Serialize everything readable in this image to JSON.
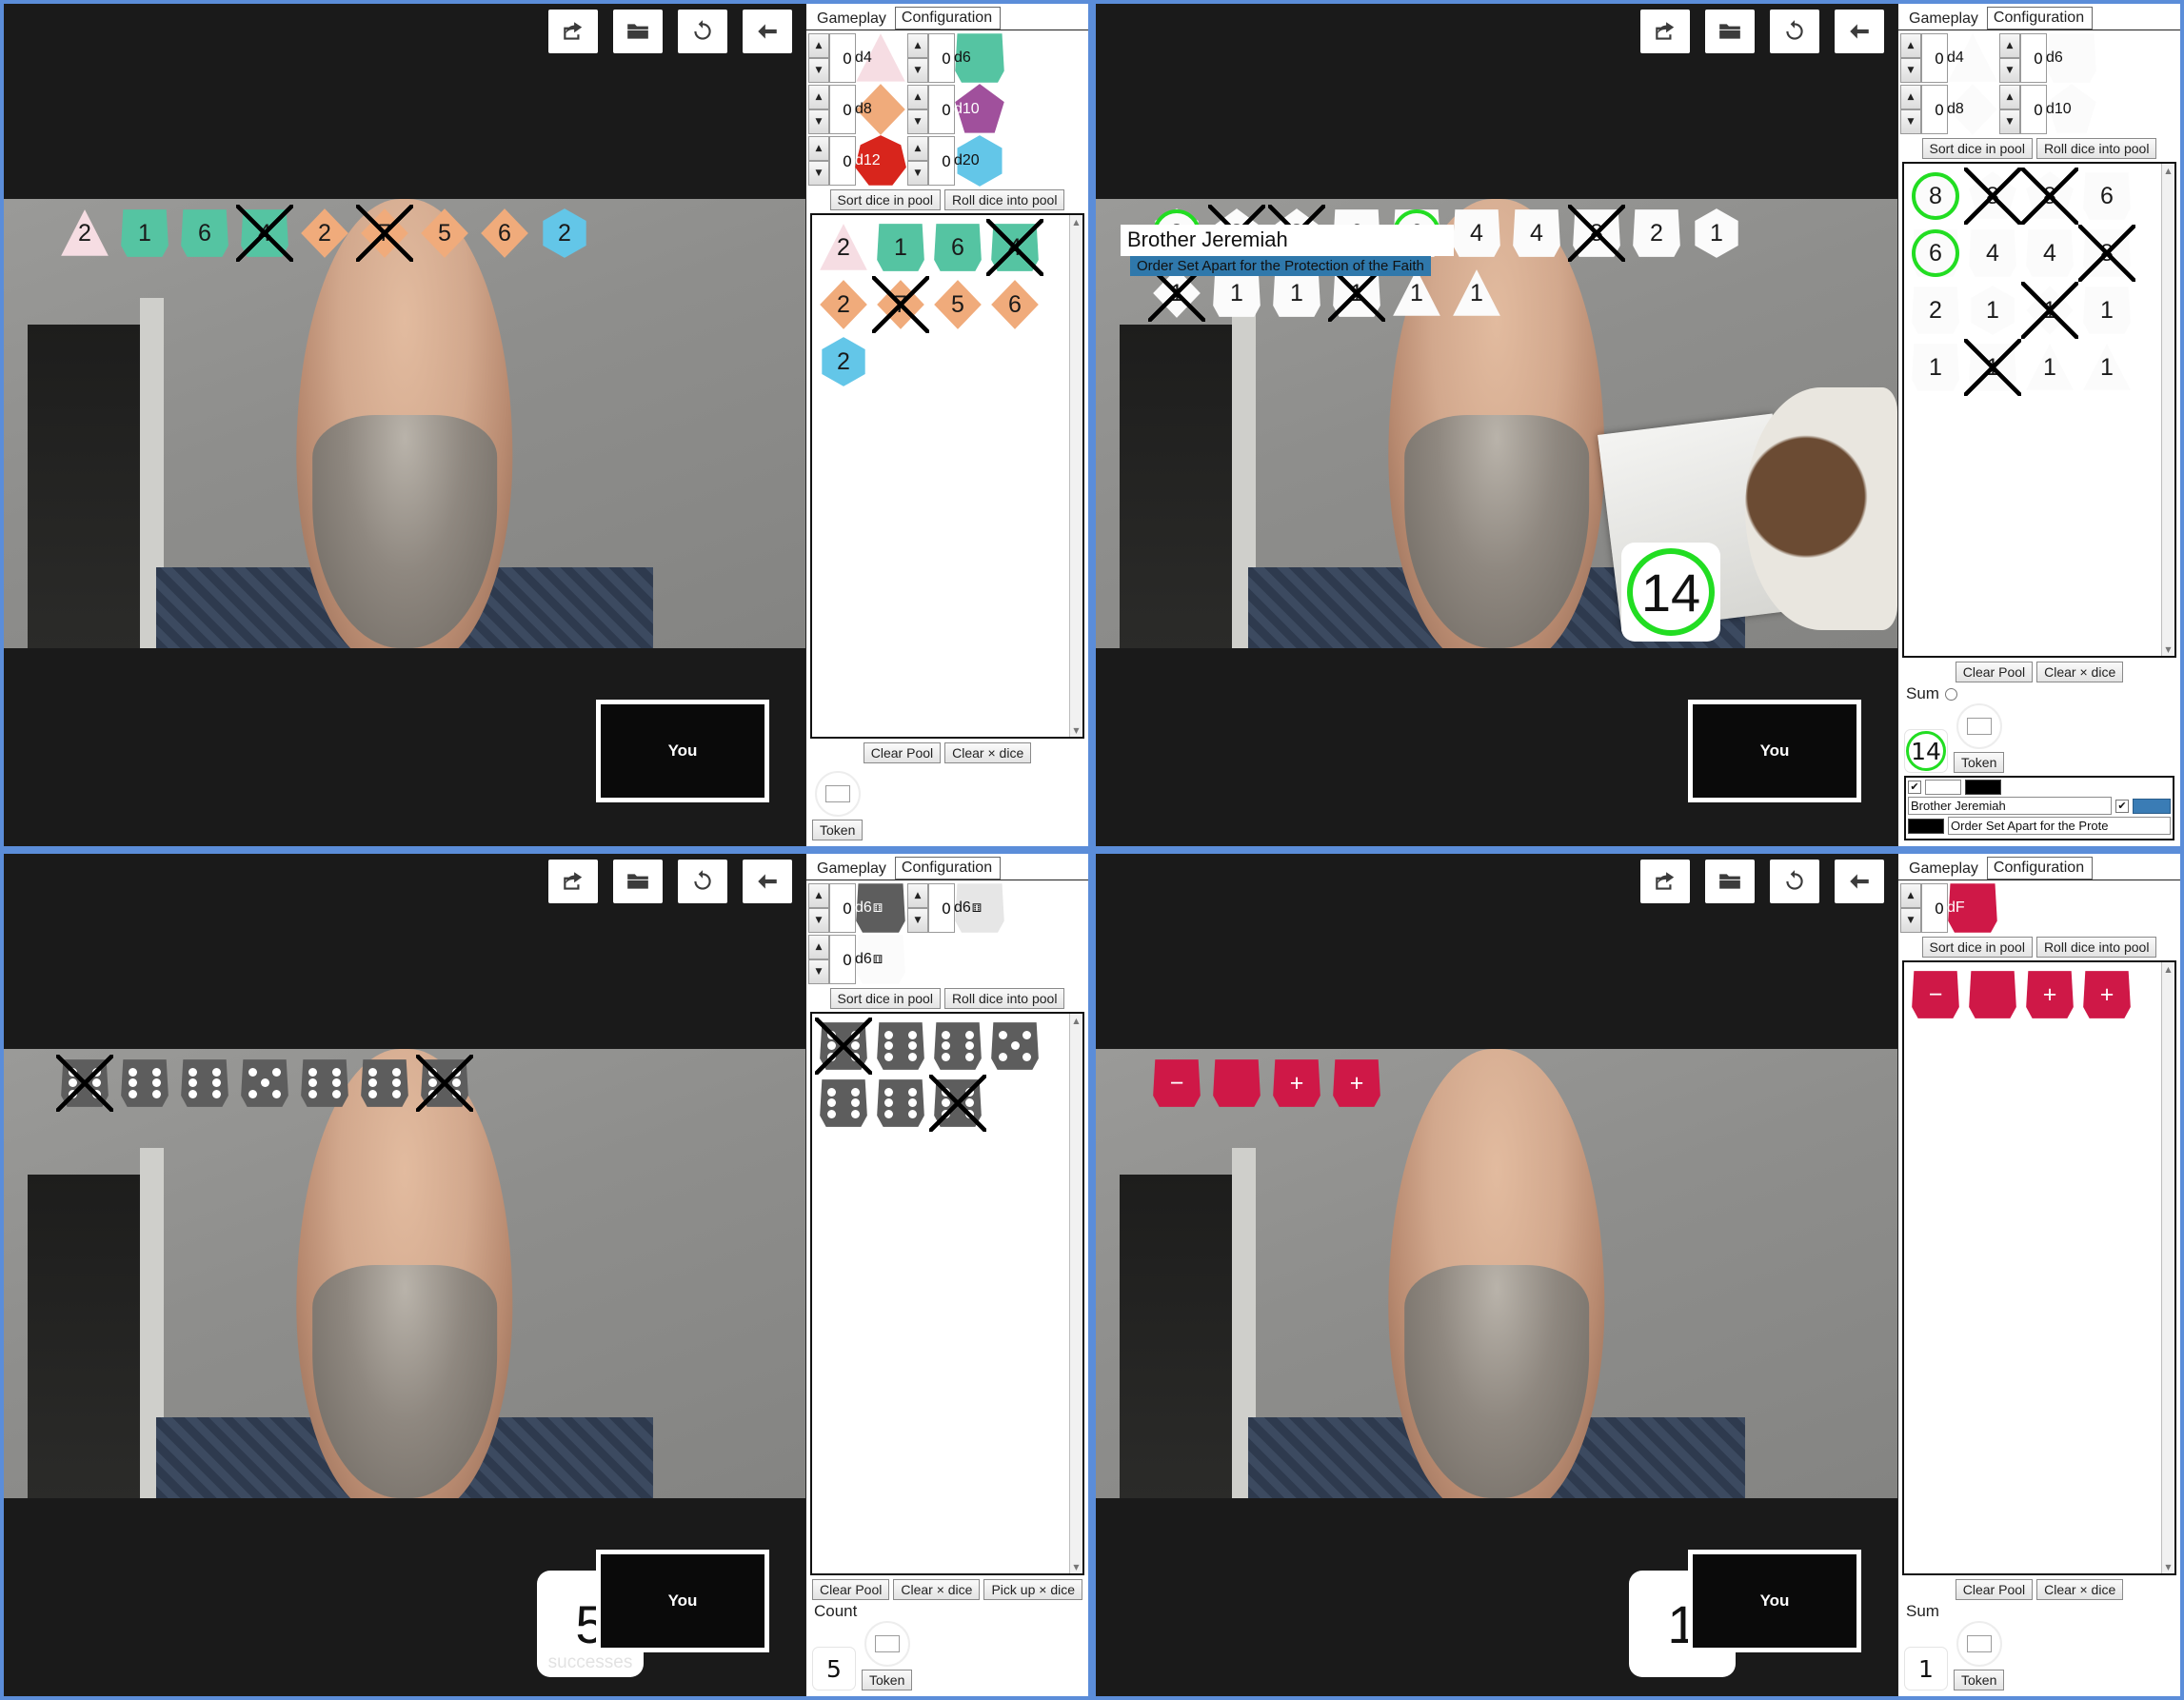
{
  "toolbar": {
    "buttons": [
      {
        "name": "share-icon",
        "label": "Share"
      },
      {
        "name": "folder-icon",
        "label": "Open"
      },
      {
        "name": "refresh-icon",
        "label": "Reload"
      },
      {
        "name": "back-arrow-icon",
        "label": "Back"
      }
    ]
  },
  "tabs": {
    "gameplay": "Gameplay",
    "configuration": "Configuration"
  },
  "buttons": {
    "sort": "Sort dice in pool",
    "roll": "Roll dice into pool",
    "clear_pool": "Clear Pool",
    "clear_x": "Clear × dice",
    "pickup_x": "Pick up × dice",
    "token": "Token"
  },
  "selfview_label": "You",
  "labels": {
    "sum": "Sum",
    "count": "Count",
    "successes": "successes"
  },
  "panels": [
    {
      "id": "panel-polyhedral-color",
      "theme": "color",
      "spinners": [
        {
          "label": "d4",
          "value": "0",
          "shape": "d4",
          "color": "c-d4",
          "text": "dark"
        },
        {
          "label": "d6",
          "value": "0",
          "shape": "d6",
          "color": "c-d6",
          "text": "dark"
        },
        {
          "label": "d8",
          "value": "0",
          "shape": "d8",
          "color": "c-d8",
          "text": "dark"
        },
        {
          "label": "d10",
          "value": "0",
          "shape": "d10",
          "color": "c-d10",
          "text": "light"
        },
        {
          "label": "d12",
          "value": "0",
          "shape": "d12",
          "color": "c-d12",
          "text": "light"
        },
        {
          "label": "d20",
          "value": "0",
          "shape": "d20",
          "color": "c-d20",
          "text": "dark"
        }
      ],
      "pool": [
        {
          "value": "2",
          "shape": "d4",
          "color": "c-d4",
          "x": false,
          "picked": false
        },
        {
          "value": "1",
          "shape": "d6",
          "color": "c-d6",
          "x": false,
          "picked": false
        },
        {
          "value": "6",
          "shape": "d6",
          "color": "c-d6",
          "x": false,
          "picked": false
        },
        {
          "value": "4",
          "shape": "d6",
          "color": "c-d6",
          "x": true,
          "picked": false
        },
        {
          "value": "2",
          "shape": "d8",
          "color": "c-d8",
          "x": false,
          "picked": false
        },
        {
          "value": "7",
          "shape": "d8",
          "color": "c-d8",
          "x": true,
          "picked": false
        },
        {
          "value": "5",
          "shape": "d8",
          "color": "c-d8",
          "x": false,
          "picked": false
        },
        {
          "value": "6",
          "shape": "d8",
          "color": "c-d8",
          "x": false,
          "picked": false
        },
        {
          "value": "2",
          "shape": "d20",
          "color": "c-d20",
          "x": false,
          "picked": false
        }
      ],
      "overlay_dice": [
        {
          "value": "2",
          "shape": "d4",
          "color": "c-d4",
          "x": false,
          "picked": false
        },
        {
          "value": "1",
          "shape": "d6",
          "color": "c-d6",
          "x": false,
          "picked": false
        },
        {
          "value": "6",
          "shape": "d6",
          "color": "c-d6",
          "x": false,
          "picked": false
        },
        {
          "value": "4",
          "shape": "d6",
          "color": "c-d6",
          "x": true,
          "picked": false
        },
        {
          "value": "2",
          "shape": "d8",
          "color": "c-d8",
          "x": false,
          "picked": false
        },
        {
          "value": "7",
          "shape": "d8",
          "color": "c-d8",
          "x": true,
          "picked": false
        },
        {
          "value": "5",
          "shape": "d8",
          "color": "c-d8",
          "x": false,
          "picked": false
        },
        {
          "value": "6",
          "shape": "d8",
          "color": "c-d8",
          "x": false,
          "picked": false
        },
        {
          "value": "2",
          "shape": "d20",
          "color": "c-d20",
          "x": false,
          "picked": false
        }
      ],
      "footer": {
        "mode": "none",
        "result": "",
        "foot_buttons": [
          "Clear Pool",
          "Clear × dice"
        ]
      }
    },
    {
      "id": "panel-polyhedral-white",
      "theme": "white",
      "spinners": [
        {
          "label": "d4",
          "value": "0",
          "shape": "d4",
          "color": "c-white",
          "text": "dark"
        },
        {
          "label": "d6",
          "value": "0",
          "shape": "d6",
          "color": "c-white",
          "text": "dark"
        },
        {
          "label": "d8",
          "value": "0",
          "shape": "d8",
          "color": "c-white",
          "text": "dark"
        },
        {
          "label": "d10",
          "value": "0",
          "shape": "d10",
          "color": "c-white",
          "text": "dark"
        }
      ],
      "pool": [
        {
          "value": "8",
          "shape": "d20",
          "color": "c-white",
          "x": false,
          "picked": true
        },
        {
          "value": "8",
          "shape": "d10",
          "color": "c-white",
          "x": true,
          "picked": false
        },
        {
          "value": "8",
          "shape": "d10",
          "color": "c-white",
          "x": true,
          "picked": false
        },
        {
          "value": "6",
          "shape": "d6",
          "color": "c-white",
          "x": false,
          "picked": false
        },
        {
          "value": "6",
          "shape": "d6",
          "color": "c-white",
          "x": false,
          "picked": true
        },
        {
          "value": "4",
          "shape": "d6",
          "color": "c-white",
          "x": false,
          "picked": false
        },
        {
          "value": "4",
          "shape": "d6",
          "color": "c-white",
          "x": false,
          "picked": false
        },
        {
          "value": "8",
          "shape": "d6",
          "color": "c-white",
          "x": true,
          "picked": false
        },
        {
          "value": "2",
          "shape": "d6",
          "color": "c-white",
          "x": false,
          "picked": false
        },
        {
          "value": "1",
          "shape": "d20",
          "color": "c-white",
          "x": false,
          "picked": false
        },
        {
          "value": "1",
          "shape": "d8",
          "color": "c-white",
          "x": true,
          "picked": false
        },
        {
          "value": "1",
          "shape": "d6",
          "color": "c-white",
          "x": false,
          "picked": false
        },
        {
          "value": "1",
          "shape": "d6",
          "color": "c-white",
          "x": false,
          "picked": false
        },
        {
          "value": "1",
          "shape": "d6",
          "color": "c-white",
          "x": true,
          "picked": false
        },
        {
          "value": "1",
          "shape": "d4",
          "color": "c-white",
          "x": false,
          "picked": false
        },
        {
          "value": "1",
          "shape": "d4",
          "color": "c-white",
          "x": false,
          "picked": false
        }
      ],
      "overlay_dice": [
        {
          "value": "8",
          "shape": "d20",
          "color": "c-white",
          "x": false,
          "picked": true
        },
        {
          "value": "8",
          "shape": "d10",
          "color": "c-white",
          "x": true,
          "picked": false
        },
        {
          "value": "8",
          "shape": "d10",
          "color": "c-white",
          "x": true,
          "picked": false
        },
        {
          "value": "6",
          "shape": "d6",
          "color": "c-white",
          "x": false,
          "picked": false
        },
        {
          "value": "6",
          "shape": "d6",
          "color": "c-white",
          "x": false,
          "picked": true
        },
        {
          "value": "4",
          "shape": "d6",
          "color": "c-white",
          "x": false,
          "picked": false
        },
        {
          "value": "4",
          "shape": "d6",
          "color": "c-white",
          "x": false,
          "picked": false
        },
        {
          "value": "8",
          "shape": "d6",
          "color": "c-white",
          "x": true,
          "picked": false
        },
        {
          "value": "2",
          "shape": "d6",
          "color": "c-white",
          "x": false,
          "picked": false
        },
        {
          "value": "1",
          "shape": "d20",
          "color": "c-white",
          "x": false,
          "picked": false
        },
        {
          "value": "1",
          "shape": "d8",
          "color": "c-white",
          "x": true,
          "picked": false
        },
        {
          "value": "1",
          "shape": "d6",
          "color": "c-white",
          "x": false,
          "picked": false
        },
        {
          "value": "1",
          "shape": "d6",
          "color": "c-white",
          "x": false,
          "picked": false
        },
        {
          "value": "1",
          "shape": "d6",
          "color": "c-white",
          "x": true,
          "picked": false
        },
        {
          "value": "1",
          "shape": "d4",
          "color": "c-white",
          "x": false,
          "picked": false
        },
        {
          "value": "1",
          "shape": "d4",
          "color": "c-white",
          "x": false,
          "picked": false
        }
      ],
      "footer": {
        "mode": "sum",
        "result": "14",
        "foot_buttons": [
          "Clear Pool",
          "Clear × dice"
        ]
      },
      "nameplate": {
        "name": "Brother Jeremiah",
        "subtitle": "Order Set Apart for the Protection of the Faith",
        "name_field_value": "Brother Jeremiah",
        "subtitle_field_value": "Order Set Apart for the Prote",
        "accent_color": "#3a7cb5"
      },
      "video_result": "14"
    },
    {
      "id": "panel-pip-d6",
      "theme": "pip",
      "spinners": [
        {
          "label": "d6",
          "value": "0",
          "shape": "d6",
          "color": "c-grey",
          "text": "light",
          "pipicon": true
        },
        {
          "label": "d6",
          "value": "0",
          "shape": "d6",
          "color": "c-lgrey",
          "text": "dark",
          "pipicon": true
        },
        {
          "label": "d6",
          "value": "0",
          "shape": "d6",
          "color": "c-white",
          "text": "dark",
          "pipicon": true
        }
      ],
      "pool": [
        {
          "pips": 6,
          "color": "c-grey",
          "x": true
        },
        {
          "pips": 6,
          "color": "c-grey",
          "x": false
        },
        {
          "pips": 6,
          "color": "c-grey",
          "x": false
        },
        {
          "pips": 5,
          "color": "c-grey",
          "x": false
        },
        {
          "pips": 6,
          "color": "c-grey",
          "x": false
        },
        {
          "pips": 6,
          "color": "c-grey",
          "x": false
        },
        {
          "pips": 6,
          "color": "c-grey",
          "x": true
        }
      ],
      "overlay_dice": [
        {
          "pips": 6,
          "color": "c-grey",
          "x": true
        },
        {
          "pips": 6,
          "color": "c-grey",
          "x": false
        },
        {
          "pips": 6,
          "color": "c-grey",
          "x": false
        },
        {
          "pips": 5,
          "color": "c-grey",
          "x": false
        },
        {
          "pips": 6,
          "color": "c-grey",
          "x": false
        },
        {
          "pips": 6,
          "color": "c-grey",
          "x": false
        },
        {
          "pips": 6,
          "color": "c-grey",
          "x": true
        }
      ],
      "footer": {
        "mode": "count",
        "result": "5",
        "foot_buttons": [
          "Clear Pool",
          "Clear × dice",
          "Pick up × dice"
        ]
      },
      "video_result": "5"
    },
    {
      "id": "panel-fudge",
      "theme": "fudge",
      "spinners": [
        {
          "label": "dF",
          "value": "0",
          "shape": "dF",
          "color": "c-dF",
          "text": "light"
        }
      ],
      "pool": [
        {
          "value": "−",
          "shape": "dF",
          "color": "c-dF",
          "x": false,
          "picked": false
        },
        {
          "value": "",
          "shape": "dF",
          "color": "c-dF",
          "x": false,
          "picked": false
        },
        {
          "value": "+",
          "shape": "dF",
          "color": "c-dF",
          "x": false,
          "picked": false
        },
        {
          "value": "+",
          "shape": "dF",
          "color": "c-dF",
          "x": false,
          "picked": false
        }
      ],
      "overlay_dice": [
        {
          "value": "−",
          "shape": "dF",
          "color": "c-dF",
          "x": false,
          "picked": false
        },
        {
          "value": "",
          "shape": "dF",
          "color": "c-dF",
          "x": false,
          "picked": false
        },
        {
          "value": "+",
          "shape": "dF",
          "color": "c-dF",
          "x": false,
          "picked": false
        },
        {
          "value": "+",
          "shape": "dF",
          "color": "c-dF",
          "x": false,
          "picked": false
        }
      ],
      "footer": {
        "mode": "sum",
        "result": "1",
        "foot_buttons": [
          "Clear Pool",
          "Clear × dice"
        ]
      },
      "video_result": "1"
    }
  ]
}
